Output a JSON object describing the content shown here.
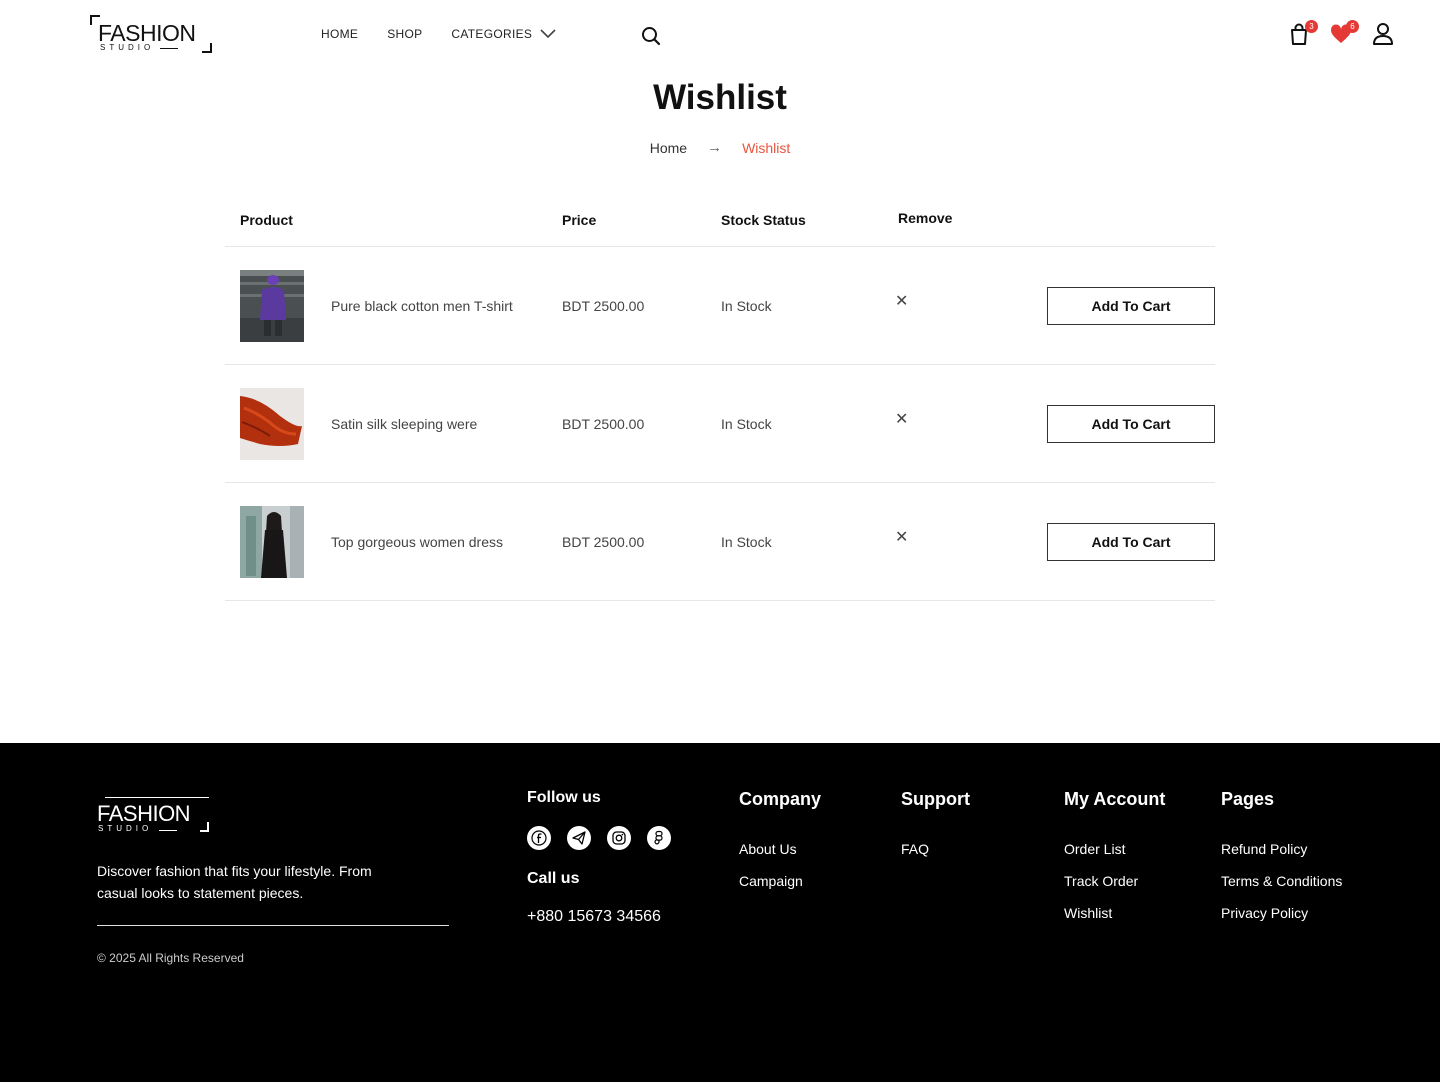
{
  "header": {
    "logo_word": "FASHION",
    "logo_sub": "STUDIO",
    "nav": [
      "HOME",
      "SHOP",
      "CATEGORIES"
    ],
    "cart_count": "3",
    "wishlist_count": "6"
  },
  "page": {
    "title": "Wishlist",
    "breadcrumb_home": "Home",
    "breadcrumb_arrow": "→",
    "breadcrumb_current": "Wishlist"
  },
  "table": {
    "headers": {
      "product": "Product",
      "price": "Price",
      "stock": "Stock Status",
      "remove": "Remove"
    },
    "rows": [
      {
        "name": "Pure black cotton men T-shirt",
        "price": "BDT 2500.00",
        "stock": "In Stock",
        "remove": "✕",
        "button": "Add To Cart"
      },
      {
        "name": "Satin silk sleeping were",
        "price": "BDT 2500.00",
        "stock": "In Stock",
        "remove": "✕",
        "button": "Add To Cart"
      },
      {
        "name": "Top gorgeous women dress",
        "price": "BDT 2500.00",
        "stock": "In Stock",
        "remove": "✕",
        "button": "Add To Cart"
      }
    ]
  },
  "footer": {
    "logo_word": "FASHION",
    "logo_sub": "STUDIO",
    "description": "Discover fashion that fits your lifestyle. From casual looks to statement pieces.",
    "copyright": "© 2025 All Rights Reserved",
    "follow_heading": "Follow us",
    "social_icons": [
      "facebook-icon",
      "telegram-icon",
      "instagram-icon",
      "figma-icon"
    ],
    "call_heading": "Call us",
    "phone": "+880 15673 34566",
    "company": {
      "heading": "Company",
      "links": [
        "About Us",
        "Campaign"
      ]
    },
    "support": {
      "heading": "Support",
      "links": [
        "FAQ"
      ]
    },
    "account": {
      "heading": "My Account",
      "links": [
        "Order List",
        "Track Order",
        "Wishlist"
      ]
    },
    "pages": {
      "heading": "Pages",
      "links": [
        "Refund Policy",
        "Terms & Conditions",
        "Privacy Policy"
      ]
    }
  },
  "colors": {
    "accent": "#e8553e",
    "badge": "#e53935",
    "footer_bg": "#000000"
  }
}
